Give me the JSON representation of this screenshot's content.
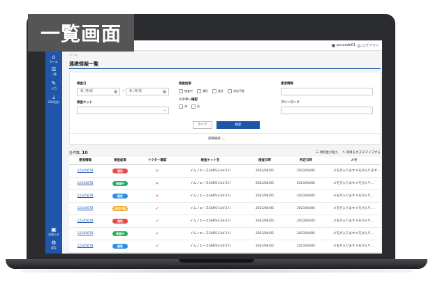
{
  "badge_label": "一覧画面",
  "colors": {
    "primary": "#1f56a9",
    "badge_bg": "#555555",
    "status_positive": "#e84a4a",
    "status_testing": "#27ae60",
    "status_negative": "#2f8fe0",
    "status_undetermined": "#f0ad2e"
  },
  "topbar": {
    "user": "pcscode01",
    "logout": "ログアウト"
  },
  "sidebar": {
    "items": [
      {
        "label": "ホーム",
        "icon": "home-icon"
      },
      {
        "label": "一覧",
        "icon": "list-icon"
      },
      {
        "label": "入力",
        "icon": "pencil-icon"
      },
      {
        "label": "CSV出力",
        "icon": "download-icon"
      }
    ],
    "bottom": [
      {
        "label": "お知らせ",
        "icon": "info-icon"
      },
      {
        "label": "設定",
        "icon": "gear-icon"
      }
    ]
  },
  "page": {
    "breadcrumb": "ホーム",
    "title": "連携情報一覧"
  },
  "search": {
    "exam_date_label": "検査日",
    "date_from_placeholder": "年 /月/日",
    "date_to_placeholder": "年 /月/日",
    "date_sep": "~",
    "kit_label": "検査キット",
    "result_label": "検査結果",
    "result_options": [
      "検査中",
      "陽性",
      "陰性",
      "判定不能"
    ],
    "doctor_label": "ドクター確認",
    "doctor_options": [
      "済",
      "未"
    ],
    "patient_label": "患者情報",
    "freeword_label": "フリーワード",
    "clear_label": "クリア",
    "search_label": "検索",
    "advanced_label": "詳細検索 ︿"
  },
  "list": {
    "total_prefix": "計",
    "total_suffix": "件数:",
    "total_count": "10",
    "sort_label": "項目並び替え",
    "customize_label": "項目をカスタマイズする",
    "headers": [
      "患者情報",
      "検査結果",
      "ドクター確認",
      "検査キット名",
      "検査日時",
      "判定日時",
      "メモ"
    ],
    "rows": [
      {
        "id": "12345678",
        "status": "陽性",
        "status_type": "positive",
        "doctor": "✕",
        "doctor_type": "x",
        "kit": "イムノエースSARS-CoV-2 II",
        "exam": "2023/04/05",
        "judge": "2023/04/05",
        "memo": "メモが入りますメモが入ります..."
      },
      {
        "id": "12345678",
        "status": "検査中",
        "status_type": "testing",
        "doctor": "✕",
        "doctor_type": "x",
        "kit": "イムノエースSARS-CoV-2 II",
        "exam": "2023/04/05",
        "judge": "2023/04/05",
        "memo": "メモが入りますメモが入り..."
      },
      {
        "id": "12345678",
        "status": "陰性",
        "status_type": "negative",
        "doctor": "✕",
        "doctor_type": "x",
        "kit": "イムノエースSARS-CoV-2 II",
        "exam": "2023/04/05",
        "judge": "2023/04/05",
        "memo": "メモが入りますメモが入り..."
      },
      {
        "id": "12345678",
        "status": "判定不能",
        "status_type": "undetermined",
        "doctor": "✓",
        "doctor_type": "ok",
        "kit": "イムノエースSARS-CoV-2 II",
        "exam": "2023/04/05",
        "judge": "2023/04/05",
        "memo": "メモが入りますメモが入り..."
      },
      {
        "id": "12345678",
        "status": "陽性",
        "status_type": "positive",
        "doctor": "✓",
        "doctor_type": "ok",
        "kit": "イムノエースSARS-CoV-2 II",
        "exam": "2023/04/05",
        "judge": "2023/04/05",
        "memo": "メモが入りますメモが入り..."
      },
      {
        "id": "12345678",
        "status": "検査中",
        "status_type": "testing",
        "doctor": "✓",
        "doctor_type": "ok",
        "kit": "イムノエースSARS-CoV-2 II",
        "exam": "2023/04/05",
        "judge": "2023/04/05",
        "memo": "メモが入りますメモが入り..."
      },
      {
        "id": "12345678",
        "status": "陰性",
        "status_type": "negative",
        "doctor": "✓",
        "doctor_type": "ok",
        "kit": "イムノエースSARS-CoV-2 II",
        "exam": "2023/04/05",
        "judge": "2023/04/05",
        "memo": "メモが入りますメモが入り..."
      }
    ]
  }
}
